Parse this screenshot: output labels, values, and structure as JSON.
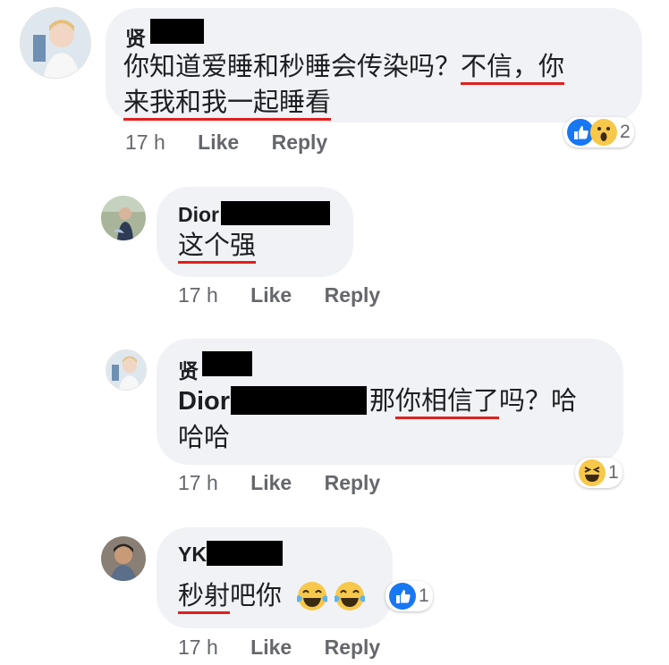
{
  "comments": [
    {
      "author": "贤",
      "text_parts": [
        {
          "text": "你知道爱睡和秒睡会传染吗？"
        },
        {
          "text": "不信，你",
          "underline": true
        },
        {
          "text": "来我和我一起睡看",
          "underline": true
        }
      ],
      "time": "17 h",
      "like_label": "Like",
      "reply_label": "Reply",
      "reaction_count": "2",
      "reaction_icons": [
        "like-icon",
        "wow-icon"
      ]
    },
    {
      "author": "Dior",
      "text_parts": [
        {
          "text": "这个强",
          "underline": true
        }
      ],
      "time": "17 h",
      "like_label": "Like",
      "reply_label": "Reply"
    },
    {
      "author": "贤",
      "mention": "Dior",
      "text_parts": [
        {
          "text": "那"
        },
        {
          "text": "你相信了",
          "underline": true
        },
        {
          "text": "吗？哈"
        },
        {
          "text": "哈哈"
        }
      ],
      "time": "17 h",
      "like_label": "Like",
      "reply_label": "Reply",
      "reaction_count": "1",
      "reaction_icons": [
        "haha-icon"
      ]
    },
    {
      "author": "YK",
      "text_parts": [
        {
          "text": "秒射",
          "underline": true
        },
        {
          "text": "吧你"
        }
      ],
      "emojis": [
        "crying-laughing-emoji",
        "crying-laughing-emoji"
      ],
      "time": "17 h",
      "like_label": "Like",
      "reply_label": "Reply",
      "reaction_count": "1",
      "reaction_icons": [
        "like-icon"
      ]
    }
  ],
  "colors": {
    "bubble": "#f0f2f5",
    "meta_text": "#65676b",
    "underline": "#e0201e",
    "like_blue": "#1877f2",
    "emoji_yellow": "#f7c84a"
  }
}
